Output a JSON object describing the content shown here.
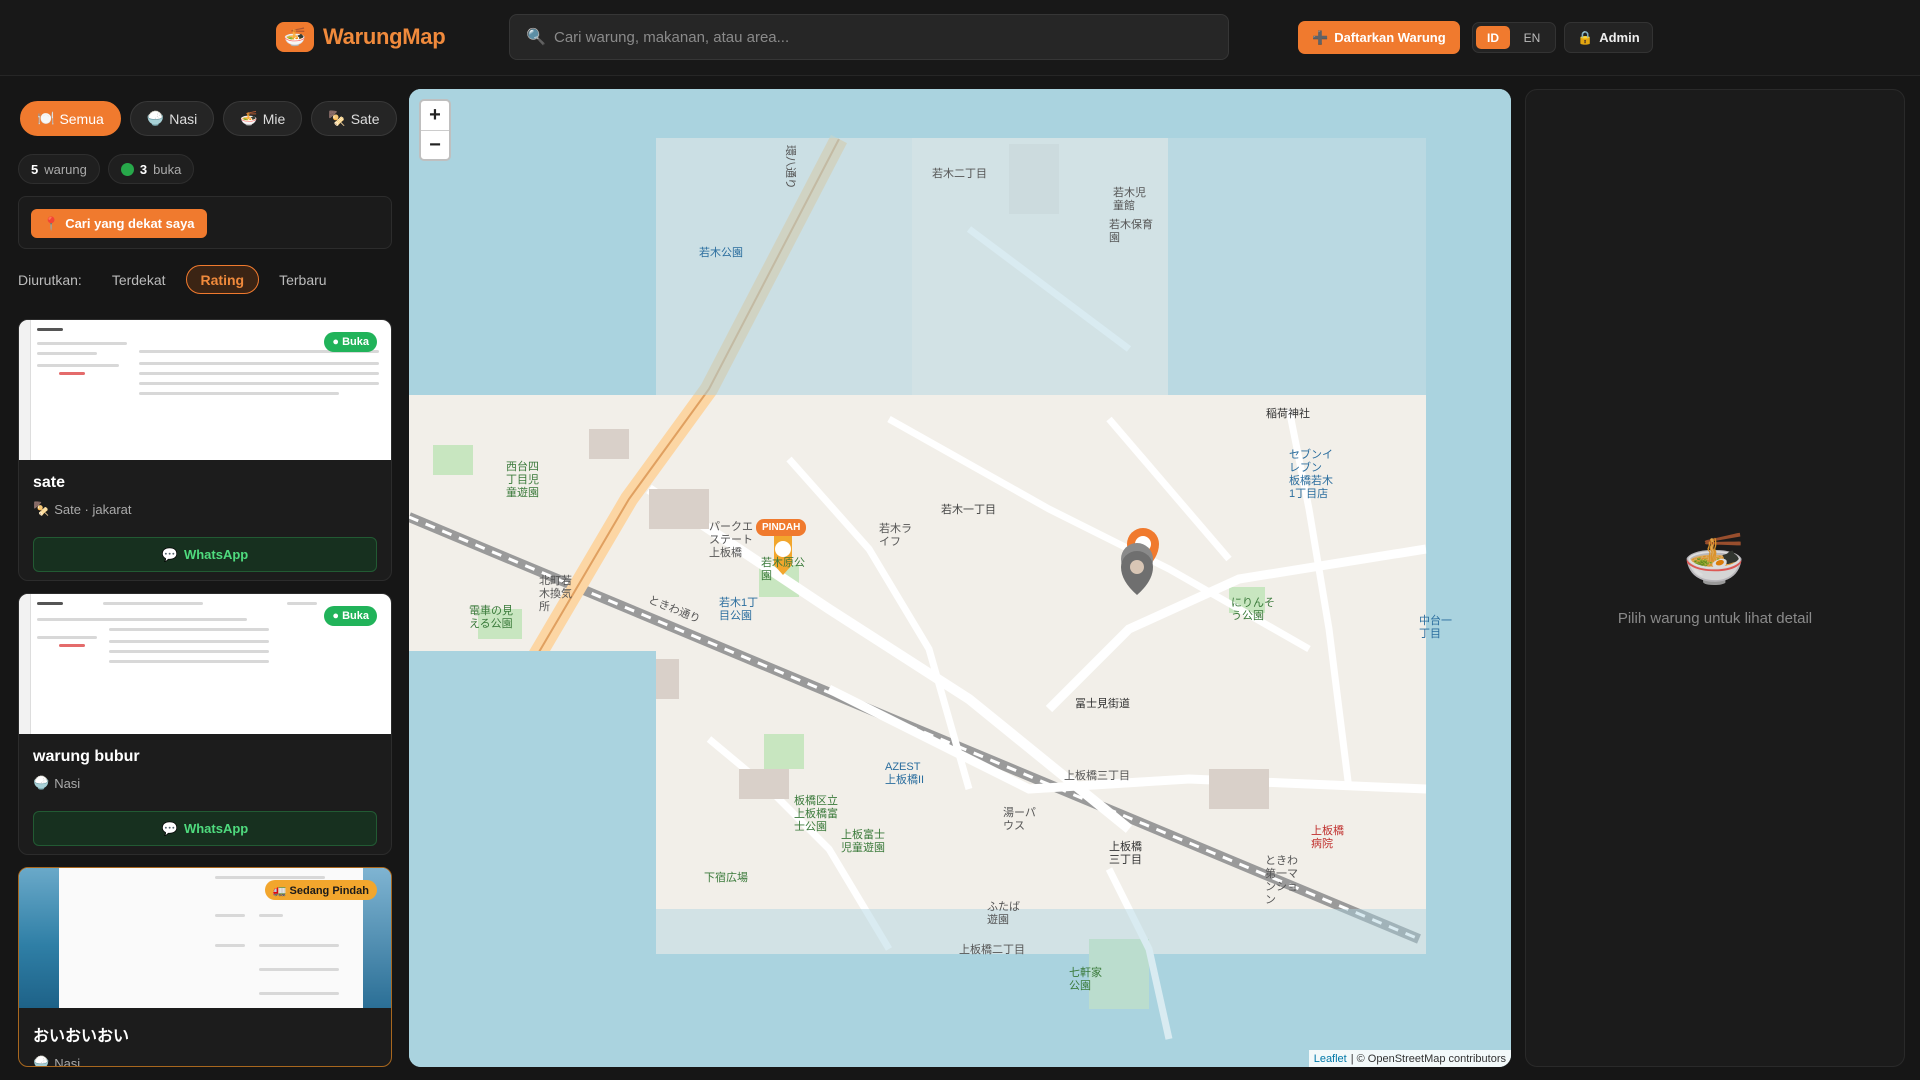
{
  "header": {
    "logo_emoji": "🍜",
    "logo_text": "WarungMap",
    "search_placeholder": "Cari warung, makanan, atau area...",
    "register_label": "Daftarkan Warung",
    "lang_active": "ID",
    "lang_other": "EN",
    "admin_label": "Admin"
  },
  "filters": [
    {
      "emoji": "🍽️",
      "label": "Semua",
      "active": true
    },
    {
      "emoji": "🍚",
      "label": "Nasi"
    },
    {
      "emoji": "🍜",
      "label": "Mie"
    },
    {
      "emoji": "🍢",
      "label": "Sate"
    }
  ],
  "stats": {
    "total_count": "5",
    "total_label": "warung",
    "open_count": "3",
    "open_label": "buka"
  },
  "nearby_label": "Cari yang dekat saya",
  "sort": {
    "label": "Diurutkan:",
    "options": [
      "Terdekat",
      "Rating",
      "Terbaru"
    ],
    "active": "Rating"
  },
  "cards": [
    {
      "name": "sate",
      "emoji": "🍢",
      "sub": "Sate · jakarat",
      "badge": "● Buka",
      "whatsapp": "WhatsApp"
    },
    {
      "name": "warung bubur",
      "emoji": "🍚",
      "sub": "Nasi",
      "badge": "● Buka",
      "whatsapp": "WhatsApp"
    },
    {
      "name": "おいおいおい",
      "emoji": "🍚",
      "sub": "Nasi",
      "badge": "🚛 Sedang Pindah"
    }
  ],
  "map": {
    "zoom_in": "+",
    "zoom_out": "−",
    "marker_label": "PINDAH",
    "attribution_link": "Leaflet",
    "attribution_text": "| © OpenStreetMap contributors",
    "labels": [
      "若木二丁目",
      "若木一丁目",
      "若木児童館",
      "若木保育園",
      "若木公園",
      "稲荷神社",
      "セブンイレブン 板橋若木1丁目店",
      "西台四丁目児童遊園",
      "パークエステート上板橋",
      "若木原公園",
      "若木1丁目公園",
      "電車の見える公園",
      "北町若木換気所",
      "ときわ通り",
      "冨士見街道",
      "にりんそう公園",
      "上板橋三丁目",
      "上板橋三丁目",
      "板橋区立上板橋富士公園",
      "上板富士児童遊園",
      "下宿広場",
      "上板橋病院",
      "ときわ第一マンション",
      "上板橋二丁目",
      "七軒家公園",
      "ふたば遊園",
      "若木ライフ",
      "湯ーパウス",
      "AZEST上板橋II",
      "中台一丁目",
      "環八通り"
    ]
  },
  "detail": {
    "emoji": "🍜",
    "hint": "Pilih warung untuk lihat detail"
  }
}
